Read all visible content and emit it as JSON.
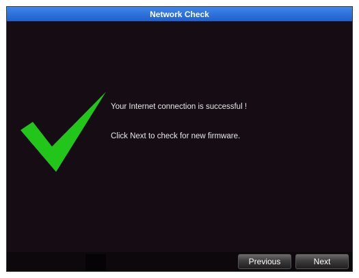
{
  "window": {
    "title": "Network Check"
  },
  "main": {
    "message_success": "Your Internet connection is successful !",
    "message_next": "Click Next to check for new firmware.",
    "icon": "checkmark-icon"
  },
  "footer": {
    "previous_label": "Previous",
    "next_label": "Next"
  },
  "colors": {
    "title_bar": "#2e74dc",
    "background": "#150d13",
    "checkmark": "#22c51a"
  }
}
